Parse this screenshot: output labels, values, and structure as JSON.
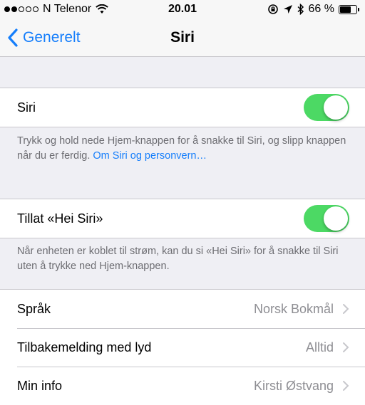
{
  "status_bar": {
    "carrier": "N Telenor",
    "time": "20.01",
    "battery_percent": "66 %",
    "battery_level": 0.66,
    "signal_bars_filled": 2,
    "signal_bars_total": 5
  },
  "nav": {
    "back_label": "Generelt",
    "title": "Siri"
  },
  "siri_group": {
    "label": "Siri",
    "enabled": true
  },
  "siri_footer": {
    "text": "Trykk og hold nede Hjem-knappen for å snakke til Siri, og slipp knappen når du er ferdig. ",
    "link": "Om Siri og personvern…"
  },
  "hey_siri_group": {
    "label": "Tillat «Hei Siri»",
    "enabled": true
  },
  "hey_siri_footer": {
    "text": "Når enheten er koblet til strøm, kan du si «Hei Siri» for å snakke til Siri uten å trykke ned Hjem-knappen."
  },
  "settings": [
    {
      "label": "Språk",
      "value": "Norsk Bokmål"
    },
    {
      "label": "Tilbakemelding med lyd",
      "value": "Alltid"
    },
    {
      "label": "Min info",
      "value": "Kirsti Østvang"
    }
  ],
  "colors": {
    "accent": "#157efb",
    "switch_on": "#4cd964",
    "background": "#efeff4"
  }
}
